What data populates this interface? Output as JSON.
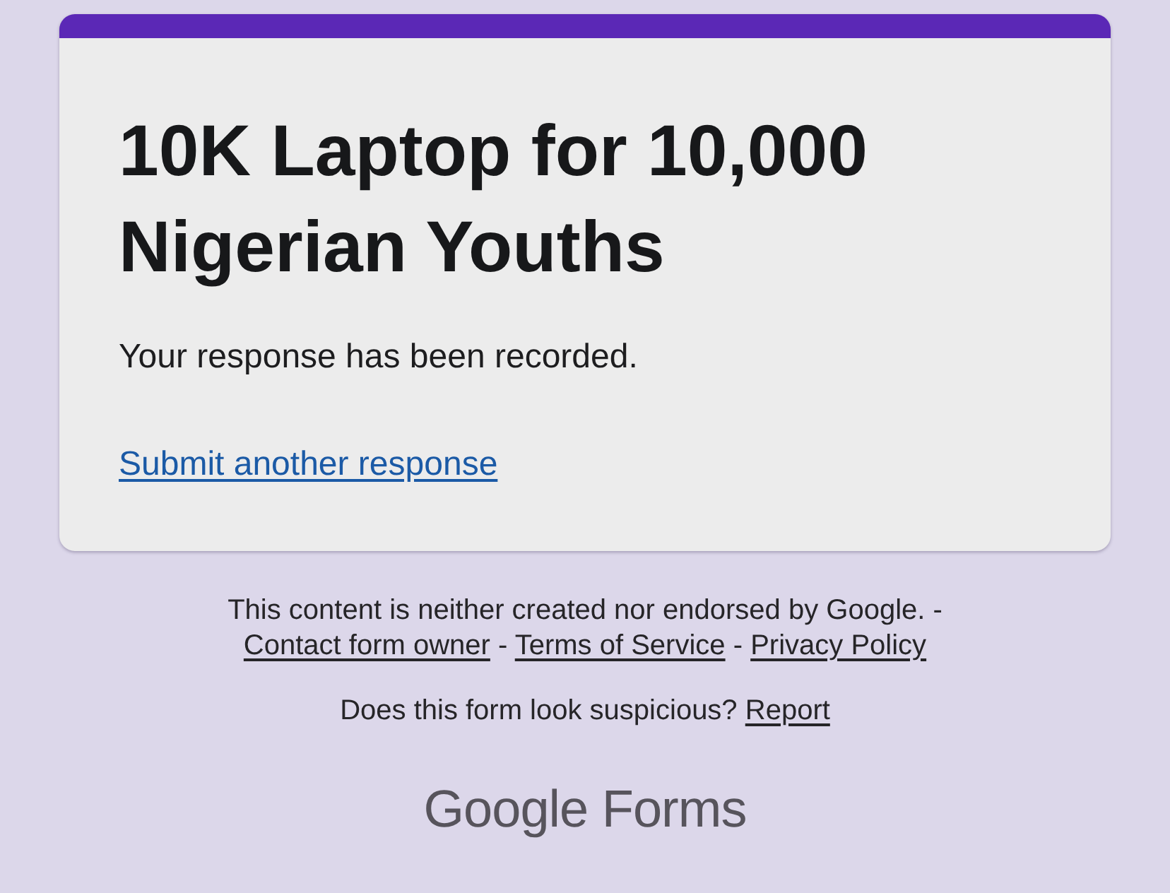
{
  "card": {
    "title": "10K Laptop for 10,000 Nigerian Youths",
    "message": "Your response has been recorded.",
    "link": "Submit another response"
  },
  "footer": {
    "disclaimer": [
      {
        "kind": "text",
        "text": "This content is neither created nor endorsed by Google. - "
      },
      {
        "kind": "link",
        "text": "Contact form owner"
      },
      {
        "kind": "text",
        "text": " - "
      },
      {
        "kind": "link",
        "text": "Terms of Service"
      },
      {
        "kind": "text",
        "text": " - "
      },
      {
        "kind": "link",
        "text": "Privacy Policy"
      }
    ],
    "report": [
      {
        "kind": "text",
        "text": "Does this form look suspicious? "
      },
      {
        "kind": "link",
        "text": "Report"
      }
    ]
  },
  "brand": {
    "logo": "Google Forms"
  }
}
